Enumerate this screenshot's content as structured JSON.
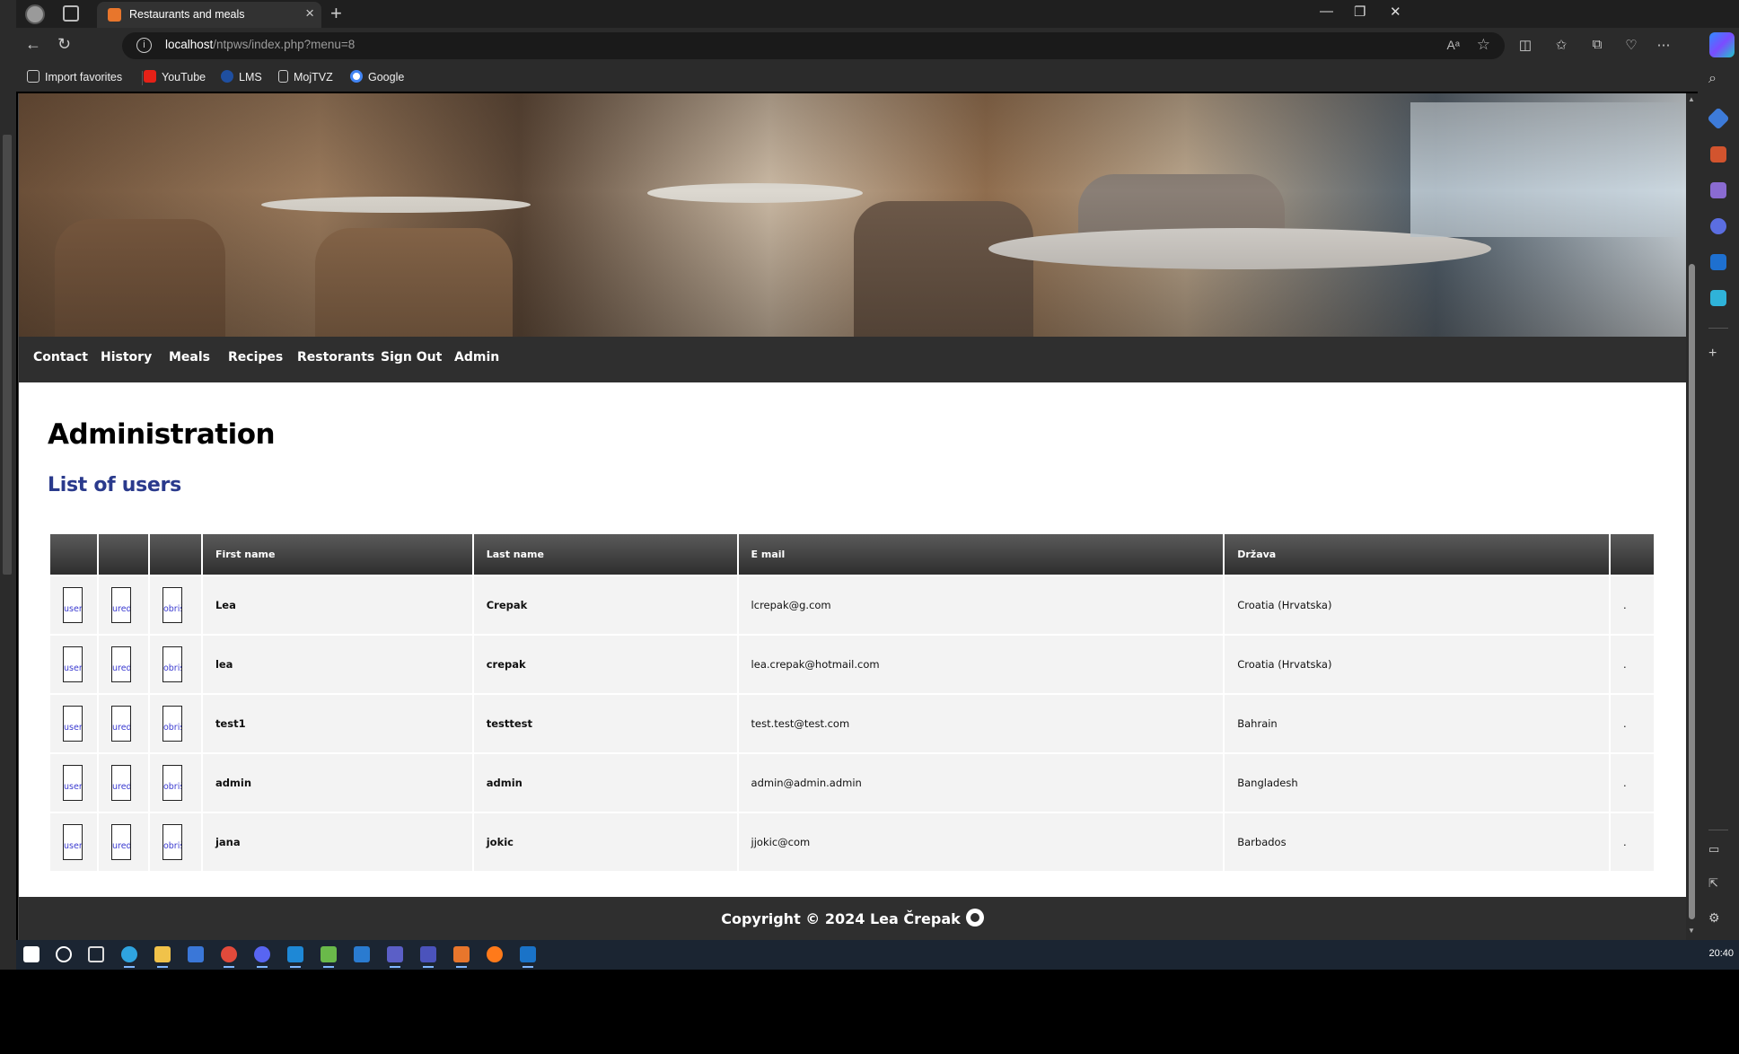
{
  "browser": {
    "tab_title": "Restaurants and meals",
    "url_host": "localhost",
    "url_path": "/ntpws/index.php?menu=8",
    "favorites": [
      "Import favorites",
      "YouTube",
      "LMS",
      "MojTVZ",
      "Google"
    ]
  },
  "nav": {
    "items": [
      "Contact",
      "History",
      "Meals",
      "Recipes",
      "Restorants",
      "Sign Out",
      "Admin"
    ]
  },
  "page": {
    "title": "Administration",
    "subtitle": "List of users"
  },
  "table": {
    "headers": [
      "",
      "",
      "",
      "First name",
      "Last name",
      "E mail",
      "Država",
      ""
    ],
    "icon_alts": [
      "user",
      "uredi",
      "obriši"
    ],
    "rows": [
      {
        "first": "Lea",
        "last": "Crepak",
        "email": "lcrepak@g.com",
        "country": "Croatia (Hrvatska)",
        "extra": "."
      },
      {
        "first": "lea",
        "last": "crepak",
        "email": "lea.crepak@hotmail.com",
        "country": "Croatia (Hrvatska)",
        "extra": "."
      },
      {
        "first": "test1",
        "last": "testtest",
        "email": "test.test@test.com",
        "country": "Bahrain",
        "extra": "."
      },
      {
        "first": "admin",
        "last": "admin",
        "email": "admin@admin.admin",
        "country": "Bangladesh",
        "extra": "."
      },
      {
        "first": "jana",
        "last": "jokic",
        "email": "jjokic@com",
        "country": "Barbados",
        "extra": "."
      }
    ]
  },
  "footer": {
    "text": "Copyright © 2024 Lea Črepak"
  },
  "taskbar": {
    "clock": "20:40"
  },
  "colors": {
    "nav_bg": "#2f2f2f",
    "subtitle": "#2a3a8c",
    "row_bg": "#f3f3f3"
  }
}
